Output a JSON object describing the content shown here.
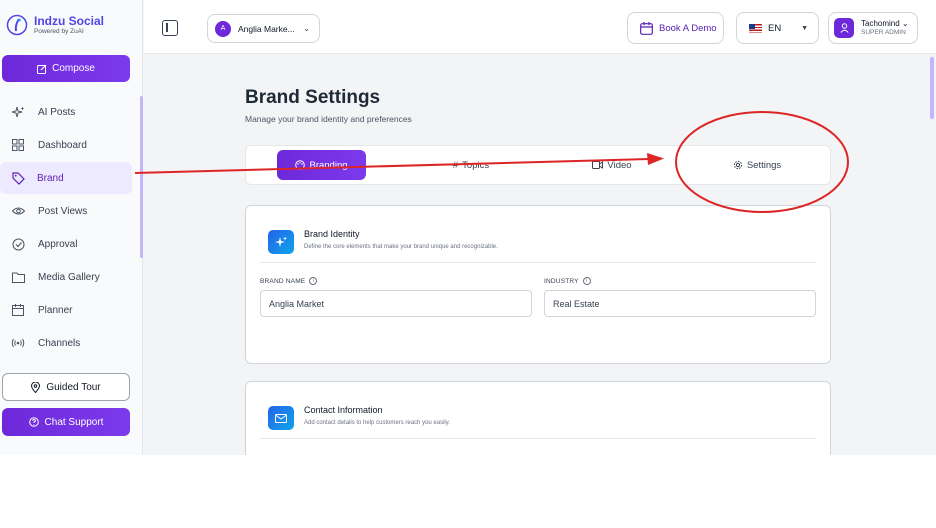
{
  "app": {
    "name": "Indzu Social",
    "tagline": "Powered by ZuAI"
  },
  "sidebar": {
    "compose_label": "Compose",
    "items": [
      {
        "label": "AI Posts",
        "icon": "sparkles-icon"
      },
      {
        "label": "Dashboard",
        "icon": "grid-icon"
      },
      {
        "label": "Brand",
        "icon": "tag-icon",
        "active": true
      },
      {
        "label": "Post Views",
        "icon": "eye-icon"
      },
      {
        "label": "Approval",
        "icon": "check-circle-icon"
      },
      {
        "label": "Media Gallery",
        "icon": "folder-icon"
      },
      {
        "label": "Planner",
        "icon": "calendar-icon"
      },
      {
        "label": "Channels",
        "icon": "broadcast-icon"
      }
    ],
    "guided_tour_label": "Guided Tour",
    "chat_support_label": "Chat Support"
  },
  "header": {
    "account_initial": "A",
    "account_name": "Anglia Marke...",
    "book_demo_label": "Book A Demo",
    "language": "EN",
    "user_name": "Tachomind",
    "user_role": "SUPER ADMIN"
  },
  "main": {
    "title": "Brand Settings",
    "subtitle": "Manage your brand identity and preferences",
    "tabs": [
      {
        "label": "Branding",
        "active": true
      },
      {
        "label": "Topics"
      },
      {
        "label": "Video"
      },
      {
        "label": "Settings"
      }
    ],
    "brand_identity": {
      "title": "Brand Identity",
      "description": "Define the core elements that make your brand unique and recognizable.",
      "brand_name_label": "BRAND NAME",
      "brand_name_value": "Anglia Market",
      "industry_label": "INDUSTRY",
      "industry_value": "Real Estate"
    },
    "contact_information": {
      "title": "Contact Information",
      "description": "Add contact details to help customers reach you easily."
    }
  },
  "colors": {
    "accent": "#6d28d9",
    "annotation": "#dc2626"
  }
}
